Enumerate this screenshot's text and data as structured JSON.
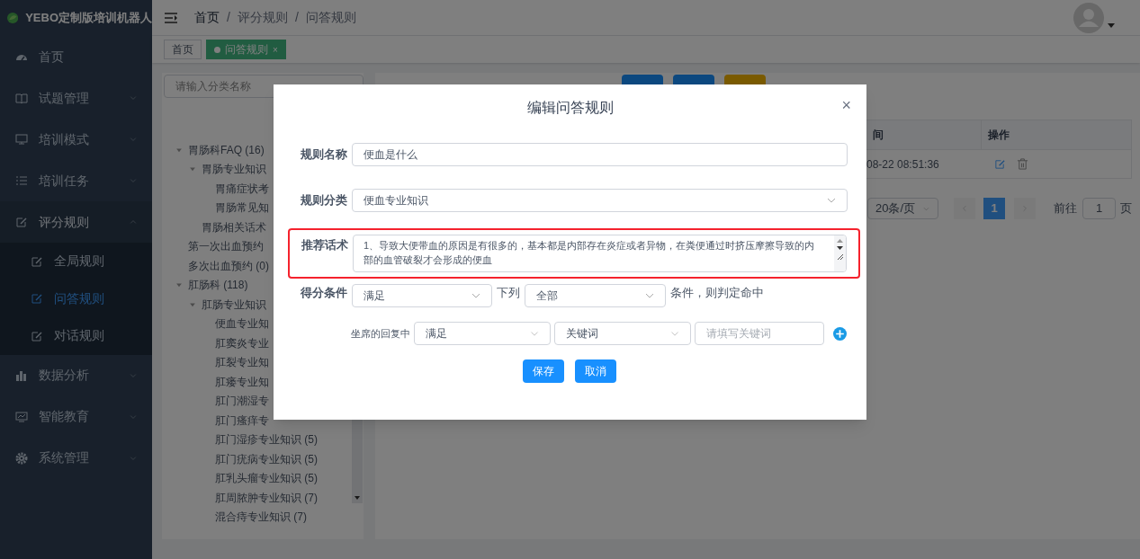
{
  "app": {
    "title": "YEBO定制版培训机器人"
  },
  "sidebar": {
    "items": [
      {
        "label": "首页"
      },
      {
        "label": "试题管理",
        "expanded": false
      },
      {
        "label": "培训模式",
        "expanded": false
      },
      {
        "label": "培训任务",
        "expanded": false
      },
      {
        "label": "评分规则",
        "expanded": true,
        "children": [
          {
            "label": "全局规则",
            "selected": false
          },
          {
            "label": "问答规则",
            "selected": true
          },
          {
            "label": "对话规则",
            "selected": false
          }
        ]
      },
      {
        "label": "数据分析",
        "expanded": false
      },
      {
        "label": "智能教育",
        "expanded": false
      },
      {
        "label": "系统管理",
        "expanded": false
      }
    ]
  },
  "breadcrumb": {
    "separator": "/",
    "items": [
      "首页",
      "评分规则",
      "问答规则"
    ]
  },
  "tags": [
    {
      "label": "首页",
      "selected": false
    },
    {
      "label": "问答规则",
      "selected": true,
      "close": "×"
    }
  ],
  "tree": {
    "search_placeholder": "请输入分类名称",
    "nodes": [
      {
        "label": "胃肠科FAQ (16)",
        "expanded": true,
        "children": [
          {
            "label": "胃肠专业知识",
            "expanded": true,
            "children": [
              {
                "label": "胃痛症状考"
              },
              {
                "label": "胃肠常见知"
              }
            ]
          },
          {
            "label": "胃肠相关话术"
          }
        ]
      },
      {
        "label": "第一次出血预约"
      },
      {
        "label": "多次出血预约 (0)"
      },
      {
        "label": "肛肠科 (118)",
        "expanded": true,
        "children": [
          {
            "label": "肛肠专业知识",
            "expanded": true,
            "children": [
              {
                "label": "便血专业知"
              },
              {
                "label": "肛窦炎专业"
              },
              {
                "label": "肛裂专业知"
              },
              {
                "label": "肛瘘专业知"
              },
              {
                "label": "肛门潮湿专"
              },
              {
                "label": "肛门瘙痒专"
              },
              {
                "label": "肛门湿疹专业知识 (5)"
              },
              {
                "label": "肛门疣病专业知识 (5)"
              },
              {
                "label": "肛乳头瘤专业知识 (5)"
              },
              {
                "label": "肛周脓肿专业知识 (7)"
              },
              {
                "label": "混合痔专业知识 (7)"
              }
            ]
          }
        ]
      }
    ]
  },
  "table": {
    "columns": [
      "间",
      "操作"
    ],
    "rows": [
      [
        "08-22 08:51:36"
      ]
    ]
  },
  "pagination": {
    "page_size": "20条/页",
    "pages": [
      {
        "label": "1",
        "selected": true
      }
    ],
    "goto_label": "前往",
    "goto_value": "1",
    "page_suffix": "页"
  },
  "dialog": {
    "title": "编辑问答规则",
    "close": "×",
    "name_label": "规则名称",
    "name_value": "便血是什么",
    "category_label": "规则分类",
    "category_value": "便血专业知识",
    "script_label": "推荐话术",
    "script_value": "1、导致大便带血的原因是有很多的，基本都是内部存在炎症或者异物，在粪便通过时挤压摩擦导致的内部的血管破裂才会形成的便血",
    "script_highlighted": true,
    "condition_label": "得分条件",
    "condition_mode": "满足",
    "condition_middle": "下列",
    "condition_scope": "全部",
    "condition_suffix": "条件，则判定命中",
    "rules": [
      {
        "label": "坐席的回复中",
        "match": "满足",
        "type": "关键词",
        "placeholder": "请填写关键词"
      }
    ],
    "buttons": [
      "保存",
      "取消"
    ]
  }
}
